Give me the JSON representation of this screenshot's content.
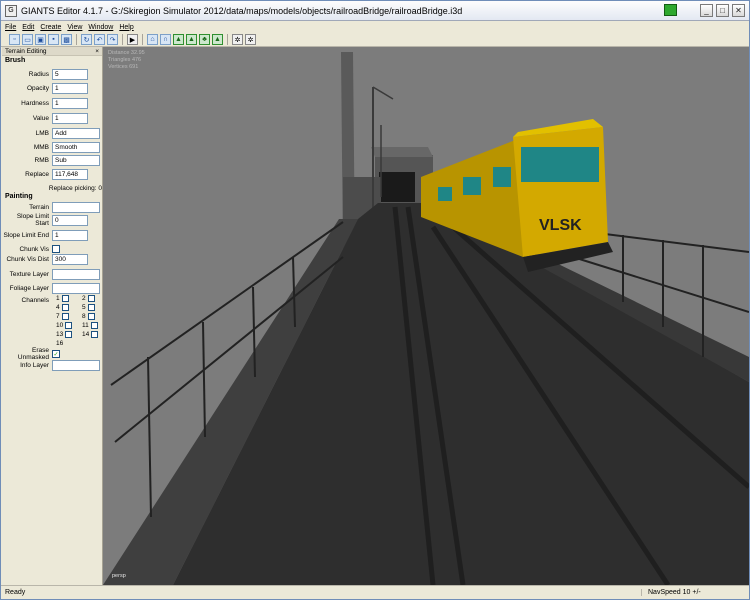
{
  "window": {
    "title": "GIANTS Editor 4.1.7 - G:/Skiregion Simulator 2012/data/maps/models/objects/railroadBridge/railroadBridge.i3d"
  },
  "menu": [
    {
      "label": "File"
    },
    {
      "label": "Edit"
    },
    {
      "label": "Create"
    },
    {
      "label": "View"
    },
    {
      "label": "Window"
    },
    {
      "label": "Help"
    }
  ],
  "panel": {
    "title": "Terrain Editing",
    "close": "×",
    "brush": {
      "title": "Brush",
      "radius": {
        "label": "Radius",
        "value": "5"
      },
      "opacity": {
        "label": "Opacity",
        "value": "1"
      },
      "hardness": {
        "label": "Hardness",
        "value": "1"
      },
      "value": {
        "label": "Value",
        "value": "1"
      },
      "lmb": {
        "label": "LMB",
        "value": "Add"
      },
      "mmb": {
        "label": "MMB",
        "value": "Smooth"
      },
      "rmb": {
        "label": "RMB",
        "value": "Sub"
      },
      "replace": {
        "label": "Replace",
        "value": "117,648"
      },
      "replace_picking": "Replace picking: 0"
    },
    "painting": {
      "title": "Painting",
      "terrain": {
        "label": "Terrain",
        "value": ""
      },
      "slope_start": {
        "label": "Slope Limit Start",
        "value": "0"
      },
      "slope_end": {
        "label": "Slope Limit End",
        "value": "1"
      },
      "chunk_vis": {
        "label": "Chunk Vis"
      },
      "chunk_vis_dist": {
        "label": "Chunk Vis Dist",
        "value": "300"
      },
      "texture_layer": {
        "label": "Texture Layer",
        "value": ""
      },
      "foliage_layer": {
        "label": "Foliage Layer",
        "value": ""
      },
      "channels": {
        "label": "Channels",
        "items": [
          "1",
          "2",
          "4",
          "5",
          "7",
          "8",
          "10",
          "11",
          "13",
          "14",
          "16"
        ]
      },
      "erase_unmasked": {
        "label": "Erase Unmasked",
        "checked": "✓"
      },
      "info_layer": {
        "label": "Info Layer",
        "value": ""
      }
    }
  },
  "viewport": {
    "stats": [
      "Distance 32.95",
      "Triangles 476",
      "Vertices 691"
    ],
    "camera": "persp",
    "train_text": "VLSK",
    "colors": {
      "sky": "#7c7c7c",
      "train": "#d3a900",
      "window": "#1f8686"
    }
  },
  "status": {
    "left": "Ready",
    "right": "NavSpeed 10 +/-"
  }
}
